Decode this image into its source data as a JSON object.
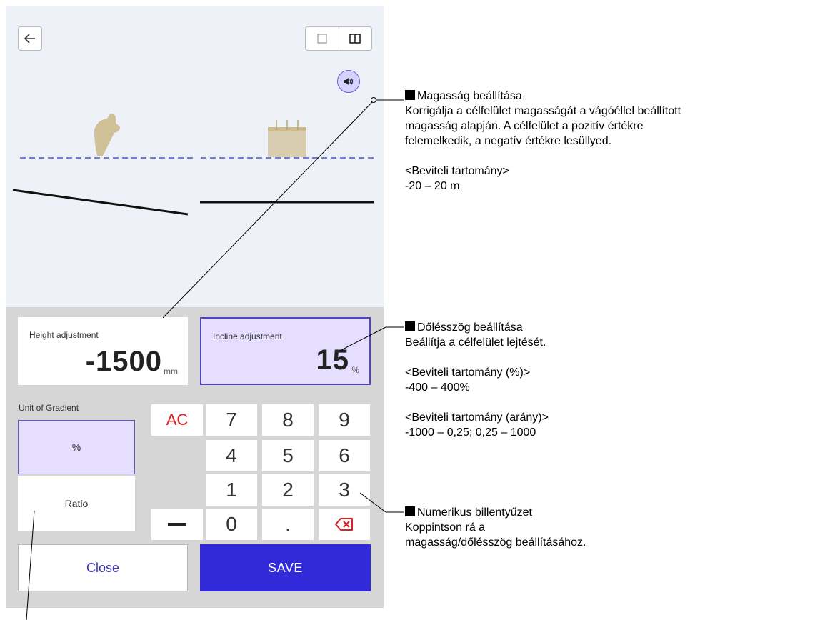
{
  "screen": {
    "sound_icon": "speaker-icon",
    "adjust": {
      "height": {
        "label": "Height adjustment",
        "value": "-1500",
        "unit": "mm"
      },
      "incline": {
        "label": "Incline adjustment",
        "value": "15",
        "unit": "%"
      }
    },
    "gradient_unit": {
      "title": "Unit of Gradient",
      "options": [
        "%",
        "Ratio"
      ],
      "selected": "%"
    },
    "keypad": {
      "ac": "AC",
      "keys": [
        "7",
        "8",
        "9",
        "4",
        "5",
        "6",
        "1",
        "2",
        "3",
        "0",
        "."
      ],
      "minus": "minus-icon",
      "backspace": "backspace-icon"
    },
    "buttons": {
      "close": "Close",
      "save": "SAVE"
    },
    "colors": {
      "accent": "#3229d9",
      "selected_bg": "#e5deff",
      "ac_red": "#d62323",
      "object": "#cfc098"
    }
  },
  "annotations": {
    "height": {
      "title": "Magasság beállítása",
      "lines": [
        "Korrigálja a célfelület magasságát a vágóéllel beállított",
        "magasság alapján. A célfelület a pozitív értékre",
        "felemelkedik, a negatív értékre lesüllyed."
      ],
      "range_title": "<Beviteli tartomány>",
      "range": "-20 – 20 m"
    },
    "incline": {
      "title": "Dőlésszög beállítása",
      "line": "Beállítja a célfelület lejtését.",
      "range_pct_title": "<Beviteli tartomány (%)>",
      "range_pct": "-400 – 400%",
      "range_ratio_title": "<Beviteli tartomány (arány)>",
      "range_ratio": "-1000 – 0,25; 0,25 – 1000"
    },
    "keypad": {
      "title": "Numerikus billentyűzet",
      "lines": [
        "Koppintson rá a",
        "magasság/dőlésszög beállításához."
      ]
    }
  }
}
